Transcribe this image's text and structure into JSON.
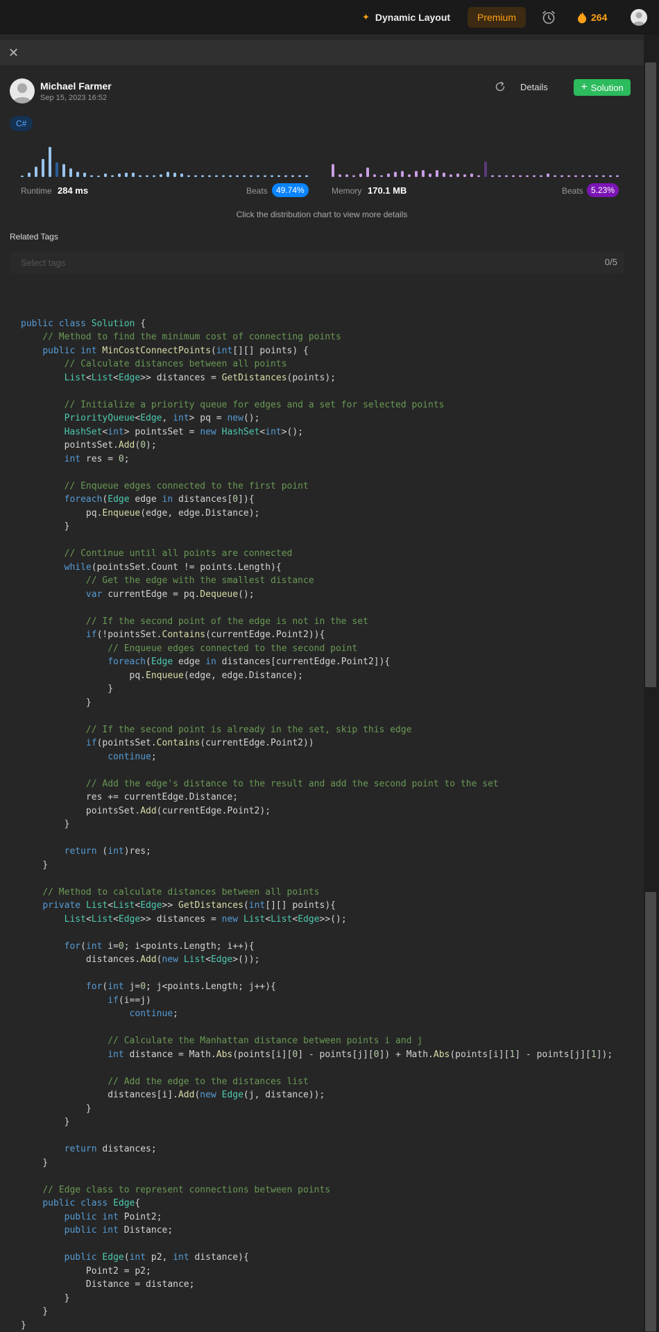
{
  "topbar": {
    "dynamic_layout": "Dynamic Layout",
    "premium": "Premium",
    "streak": "264"
  },
  "submission": {
    "user_name": "Michael Farmer",
    "date": "Sep 15, 2023 16:52",
    "details": "Details",
    "solution": "Solution",
    "language": "C#"
  },
  "stats": {
    "runtime_label": "Runtime",
    "runtime_value": "284 ms",
    "runtime_beats_label": "Beats",
    "runtime_beats": "49.74%",
    "memory_label": "Memory",
    "memory_value": "170.1 MB",
    "memory_beats_label": "Beats",
    "memory_beats": "5.23%",
    "hint": "Click the distribution chart to view more details",
    "runtime_bars": [
      2,
      10,
      24,
      42,
      70,
      34,
      30,
      20,
      12,
      10,
      4,
      2,
      8,
      4,
      8,
      10,
      10,
      4,
      4,
      4,
      6,
      12,
      10,
      8,
      4,
      4,
      4,
      4,
      4,
      4,
      4,
      4,
      4,
      4,
      4,
      4,
      4,
      4,
      4,
      4,
      4,
      4,
      4
    ],
    "runtime_active_index": 5,
    "memory_bars": [
      30,
      6,
      6,
      4,
      8,
      22,
      6,
      4,
      8,
      12,
      14,
      6,
      14,
      16,
      8,
      16,
      10,
      6,
      8,
      6,
      8,
      4,
      36,
      4,
      4,
      4,
      4,
      4,
      4,
      4,
      4,
      8,
      4,
      4,
      4,
      4,
      4,
      4,
      4,
      4,
      4,
      4,
      4,
      4
    ],
    "memory_active_index": 22,
    "colors": {
      "runtime": "#9ac4ee",
      "runtime_active": "#2c5d96",
      "memory": "#c99ee6",
      "memory_active": "#5a3a7a"
    }
  },
  "tags": {
    "label": "Related Tags",
    "placeholder": "Select tags",
    "count": "0/5"
  },
  "code_lines": [
    "",
    "public class Solution {",
    "    // Method to find the minimum cost of connecting points",
    "    public int MinCostConnectPoints(int[][] points) {",
    "        // Calculate distances between all points",
    "        List<List<Edge>> distances = GetDistances(points);",
    "",
    "        // Initialize a priority queue for edges and a set for selected points",
    "        PriorityQueue<Edge, int> pq = new();",
    "        HashSet<int> pointsSet = new HashSet<int>();",
    "        pointsSet.Add(0);",
    "        int res = 0;",
    "",
    "        // Enqueue edges connected to the first point",
    "        foreach(Edge edge in distances[0]){",
    "            pq.Enqueue(edge, edge.Distance);",
    "        }",
    "",
    "        // Continue until all points are connected",
    "        while(pointsSet.Count != points.Length){",
    "            // Get the edge with the smallest distance",
    "            var currentEdge = pq.Dequeue();",
    "",
    "            // If the second point of the edge is not in the set",
    "            if(!pointsSet.Contains(currentEdge.Point2)){",
    "                // Enqueue edges connected to the second point",
    "                foreach(Edge edge in distances[currentEdge.Point2]){",
    "                    pq.Enqueue(edge, edge.Distance);",
    "                }",
    "            }",
    "",
    "            // If the second point is already in the set, skip this edge",
    "            if(pointsSet.Contains(currentEdge.Point2))",
    "                continue;",
    "",
    "            // Add the edge's distance to the result and add the second point to the set",
    "            res += currentEdge.Distance;",
    "            pointsSet.Add(currentEdge.Point2);",
    "        }",
    "",
    "        return (int)res;",
    "    }",
    "",
    "    // Method to calculate distances between all points",
    "    private List<List<Edge>> GetDistances(int[][] points){",
    "        List<List<Edge>> distances = new List<List<Edge>>();",
    "",
    "        for(int i=0; i<points.Length; i++){",
    "            distances.Add(new List<Edge>());",
    "",
    "            for(int j=0; j<points.Length; j++){",
    "                if(i==j)",
    "                    continue;",
    "",
    "                // Calculate the Manhattan distance between points i and j",
    "                int distance = Math.Abs(points[i][0] - points[j][0]) + Math.Abs(points[i][1] - points[j][1]);",
    "",
    "                // Add the edge to the distances list",
    "                distances[i].Add(new Edge(j, distance));",
    "            }",
    "        }",
    "",
    "        return distances;",
    "    }",
    "",
    "    // Edge class to represent connections between points",
    "    public class Edge{",
    "        public int Point2;",
    "        public int Distance;",
    "",
    "        public Edge(int p2, int distance){",
    "            Point2 = p2;",
    "            Distance = distance;",
    "        }",
    "    }",
    "}"
  ]
}
